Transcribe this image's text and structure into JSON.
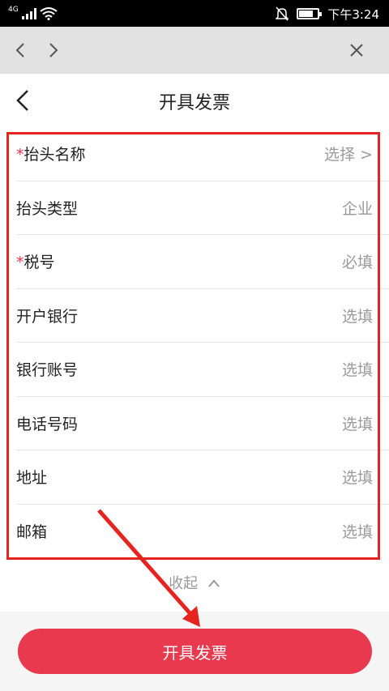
{
  "status_bar": {
    "network": "4G",
    "time": "下午3:24"
  },
  "page": {
    "title": "开具发票",
    "collapse_label": "收起",
    "submit_label": "开具发票"
  },
  "form": {
    "rows": [
      {
        "required_mark": "*",
        "label": "抬头名称",
        "value": "选择 >"
      },
      {
        "required_mark": "",
        "label": "抬头类型",
        "value": "企业"
      },
      {
        "required_mark": "*",
        "label": "税号",
        "value": "必填"
      },
      {
        "required_mark": "",
        "label": "开户银行",
        "value": "选填"
      },
      {
        "required_mark": "",
        "label": "银行账号",
        "value": "选填"
      },
      {
        "required_mark": "",
        "label": "电话号码",
        "value": "选填"
      },
      {
        "required_mark": "",
        "label": "地址",
        "value": "选填"
      },
      {
        "required_mark": "",
        "label": "邮箱",
        "value": "选填"
      }
    ]
  },
  "colors": {
    "accent": "#e8394f",
    "annotation": "#e6231e"
  },
  "icons": [
    "back-icon",
    "forward-icon",
    "close-icon",
    "chevron-left-icon",
    "chevron-up-icon",
    "wifi-icon",
    "bell-off-icon",
    "battery-icon"
  ]
}
